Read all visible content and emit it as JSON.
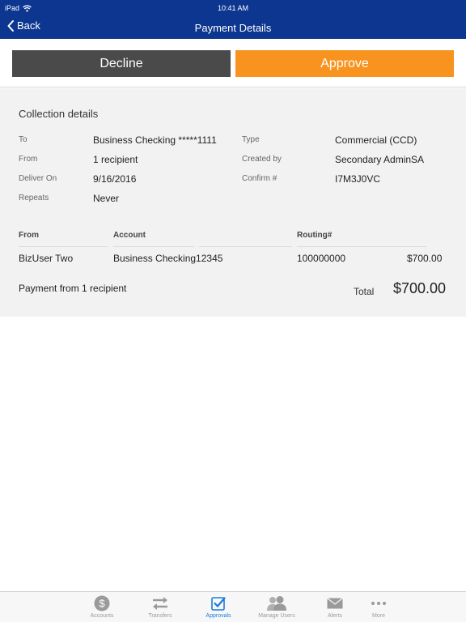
{
  "status_bar": {
    "device": "iPad",
    "time": "10:41 AM"
  },
  "navbar": {
    "back_label": "Back",
    "title": "Payment Details"
  },
  "actions": {
    "decline_label": "Decline",
    "approve_label": "Approve"
  },
  "collection": {
    "title": "Collection details",
    "left": [
      {
        "label": "To",
        "value": "Business Checking *****1111"
      },
      {
        "label": "From",
        "value": "1 recipient"
      },
      {
        "label": "Deliver On",
        "value": "9/16/2016"
      },
      {
        "label": "Repeats",
        "value": "Never"
      }
    ],
    "right": [
      {
        "label": "Type",
        "value": "Commercial (CCD)"
      },
      {
        "label": "Created by",
        "value": "Secondary AdminSA"
      },
      {
        "label": "Confirm #",
        "value": "I7M3J0VC"
      }
    ]
  },
  "recipients_table": {
    "headers": {
      "from": "From",
      "account": "Account",
      "routing": "Routing#"
    },
    "rows": [
      {
        "from": "BizUser Two",
        "account": "Business Checking12345",
        "routing": "100000000",
        "amount": "$700.00"
      }
    ]
  },
  "summary": {
    "text": "Payment from 1 recipient",
    "total_label": "Total",
    "total_value": "$700.00"
  },
  "tabbar": {
    "tabs": [
      {
        "label": "Accounts",
        "icon": "dollar-circle-icon"
      },
      {
        "label": "Transfers",
        "icon": "transfer-arrows-icon"
      },
      {
        "label": "Approvals",
        "icon": "checkbox-icon",
        "active": true
      },
      {
        "label": "Manage Users",
        "icon": "users-icon"
      },
      {
        "label": "Alerts",
        "icon": "envelope-icon"
      },
      {
        "label": "More",
        "icon": "more-dots-icon"
      }
    ]
  },
  "colors": {
    "header": "#0d3690",
    "decline": "#4a4a4a",
    "approve": "#f7931e",
    "active_tab": "#1a7cd9"
  }
}
